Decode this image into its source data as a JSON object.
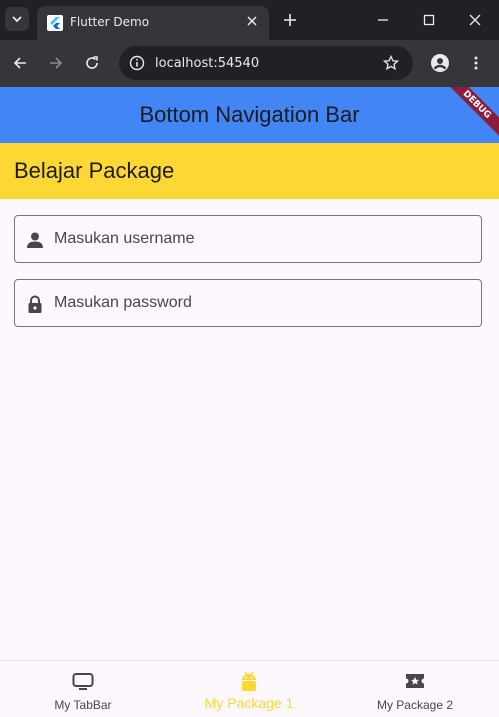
{
  "browser": {
    "tab_title": "Flutter Demo",
    "url": "localhost:54540"
  },
  "app": {
    "appbar_title": "Bottom Navigation Bar",
    "debug_label": "DEBUG",
    "section_title": "Belajar Package"
  },
  "form": {
    "username_placeholder": "Masukan username",
    "password_placeholder": "Masukan password"
  },
  "bottom_nav": {
    "items": [
      {
        "label": "My TabBar",
        "icon": "tv-icon",
        "active": false
      },
      {
        "label": "My Package 1",
        "icon": "android-icon",
        "active": true
      },
      {
        "label": "My Package 2",
        "icon": "local-activity-icon",
        "active": false
      }
    ]
  },
  "colors": {
    "appbar": "#4285f4",
    "subbar": "#fdd835",
    "active_nav": "#fdd835",
    "page_bg": "#fdf7fe"
  }
}
